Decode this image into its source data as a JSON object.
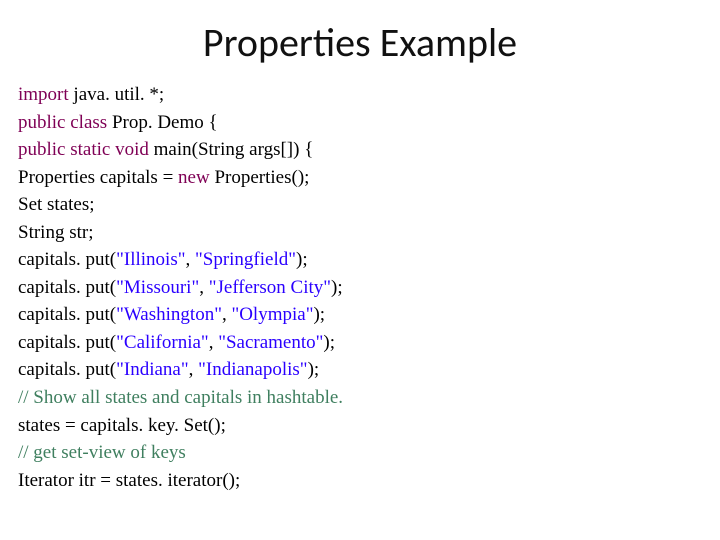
{
  "title": "Properties Example",
  "code": {
    "l1": {
      "a": "import ",
      "b": "java. util. *;",
      "c": ""
    },
    "l2": {
      "a": "public class ",
      "b": "Prop. Demo ",
      "c": "{"
    },
    "l3": {
      "a": "public static void ",
      "b": "main(String ",
      "c": "args[]) {"
    },
    "l4": {
      "a": "Properties ",
      "b": "capitals = ",
      "c": "new ",
      "d": "Properties();"
    },
    "l5": {
      "a": "Set ",
      "b": "states;"
    },
    "l6": {
      "a": "String ",
      "b": "str;"
    },
    "l7": {
      "a": "capitals. put(",
      "b": "\"Illinois\"",
      "c": ", ",
      "d": "\"Springfield\"",
      "e": ");"
    },
    "l8": {
      "a": "capitals. put(",
      "b": "\"Missouri\"",
      "c": ", ",
      "d": "\"Jefferson City\"",
      "e": ");"
    },
    "l9": {
      "a": "capitals. put(",
      "b": "\"Washington\"",
      "c": ", ",
      "d": "\"Olympia\"",
      "e": ");"
    },
    "l10": {
      "a": "capitals. put(",
      "b": "\"California\"",
      "c": ", ",
      "d": "\"Sacramento\"",
      "e": ");"
    },
    "l11": {
      "a": "capitals. put(",
      "b": "\"Indiana\"",
      "c": ", ",
      "d": "\"Indianapolis\"",
      "e": ");"
    },
    "l12": {
      "a": "// Show all states and capitals in hashtable."
    },
    "l13": {
      "a": "states = capitals. key. Set();"
    },
    "l14": {
      "a": "// get set-view of keys"
    },
    "l15": {
      "a": "Iterator ",
      "b": "itr = states. iterator();"
    }
  }
}
